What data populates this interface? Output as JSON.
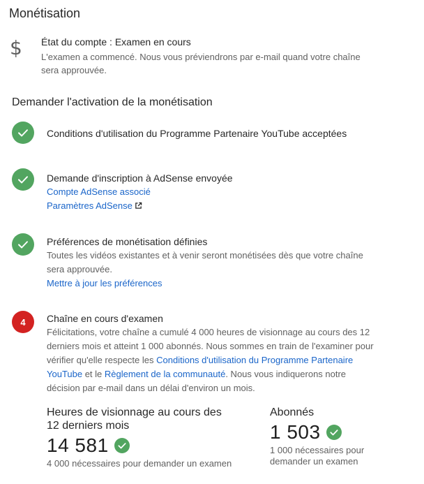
{
  "header": {
    "title": "Monétisation"
  },
  "account_status": {
    "icon": "dollar-icon",
    "title": "État du compte : Examen en cours",
    "description": "L'examen a commencé. Nous vous préviendrons par e-mail quand votre chaîne sera approuvée."
  },
  "activation": {
    "title": "Demander l'activation de la monétisation",
    "steps": [
      {
        "status": "done",
        "title": "Conditions d'utilisation du Programme Partenaire YouTube acceptées"
      },
      {
        "status": "done",
        "title": "Demande d'inscription à AdSense envoyée",
        "links": [
          "Compte AdSense associé",
          "Paramètres AdSense"
        ]
      },
      {
        "status": "done",
        "title": "Préférences de monétisation définies",
        "description": "Toutes les vidéos existantes et à venir seront monétisées dès que votre chaîne sera approuvée.",
        "links": [
          "Mettre à jour les préférences"
        ]
      },
      {
        "status": "pending",
        "number": "4",
        "title": "Chaîne en cours d'examen",
        "description_part1": "Félicitations, votre chaîne a cumulé 4 000 heures de visionnage au cours des 12 derniers mois et atteint 1 000 abonnés. Nous sommes en train de l'examiner pour vérifier qu'elle respecte les ",
        "link_terms": "Conditions d'utilisation du Programme Partenaire YouTube",
        "description_part2": " et le ",
        "link_guidelines": "Règlement de la communauté",
        "description_part3": ". Nous vous indiquerons notre décision par e-mail dans un délai d'environ un mois."
      }
    ]
  },
  "stats": {
    "watch_hours": {
      "label": "Heures de visionnage au cours des 12 derniers mois",
      "value": "14 581",
      "note": "4 000 nécessaires pour demander un examen"
    },
    "subscribers": {
      "label": "Abonnés",
      "value": "1 503",
      "note": "1 000 nécessaires pour demander un examen"
    }
  },
  "colors": {
    "success": "#52a560",
    "pending": "#d32221",
    "link": "#1a65c9",
    "secondary_text": "#606060"
  }
}
